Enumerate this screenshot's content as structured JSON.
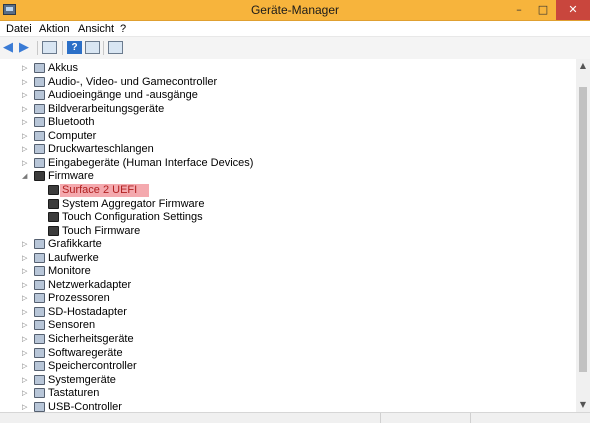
{
  "window": {
    "title": "Geräte-Manager",
    "minimize_glyph": "–",
    "maximize_glyph": "□",
    "close_glyph": "✕"
  },
  "menubar": {
    "items": [
      "Datei",
      "Aktion",
      "Ansicht",
      "?"
    ]
  },
  "toolbar": {
    "back_glyph": "◀",
    "forward_glyph": "▶",
    "help_glyph": "?"
  },
  "tree": {
    "collapsed_glyph": "▷",
    "expanded_glyph": "◢",
    "items": [
      {
        "label": "Akkus",
        "icon": "battery-icon",
        "expanded": false
      },
      {
        "label": "Audio-, Video- und Gamecontroller",
        "icon": "speaker-icon",
        "expanded": false
      },
      {
        "label": "Audioeingänge und -ausgänge",
        "icon": "speaker-icon",
        "expanded": false
      },
      {
        "label": "Bildverarbeitungsgeräte",
        "icon": "camera-icon",
        "expanded": false
      },
      {
        "label": "Bluetooth",
        "icon": "bluetooth-icon",
        "expanded": false
      },
      {
        "label": "Computer",
        "icon": "computer-icon",
        "expanded": false
      },
      {
        "label": "Druckwarteschlangen",
        "icon": "printer-icon",
        "expanded": false
      },
      {
        "label": "Eingabegeräte (Human Interface Devices)",
        "icon": "hid-icon",
        "expanded": false
      },
      {
        "label": "Firmware",
        "icon": "firmware-icon",
        "expanded": true
      },
      {
        "label": "Surface 2 UEFI",
        "icon": "firmware-chip-icon",
        "child": true,
        "selected": true
      },
      {
        "label": "System Aggregator Firmware",
        "icon": "firmware-chip-icon",
        "child": true
      },
      {
        "label": "Touch Configuration Settings",
        "icon": "firmware-chip-icon",
        "child": true
      },
      {
        "label": "Touch Firmware",
        "icon": "firmware-chip-icon",
        "child": true
      },
      {
        "label": "Grafikkarte",
        "icon": "display-adapter-icon",
        "expanded": false
      },
      {
        "label": "Laufwerke",
        "icon": "drive-icon",
        "expanded": false
      },
      {
        "label": "Monitore",
        "icon": "monitor-icon",
        "expanded": false
      },
      {
        "label": "Netzwerkadapter",
        "icon": "network-icon",
        "expanded": false
      },
      {
        "label": "Prozessoren",
        "icon": "processor-icon",
        "expanded": false
      },
      {
        "label": "SD-Hostadapter",
        "icon": "sd-card-icon",
        "expanded": false
      },
      {
        "label": "Sensoren",
        "icon": "sensor-icon",
        "expanded": false
      },
      {
        "label": "Sicherheitsgeräte",
        "icon": "key-icon",
        "expanded": false
      },
      {
        "label": "Softwaregeräte",
        "icon": "software-device-icon",
        "expanded": false
      },
      {
        "label": "Speichercontroller",
        "icon": "storage-controller-icon",
        "expanded": false
      },
      {
        "label": "Systemgeräte",
        "icon": "system-device-icon",
        "expanded": false
      },
      {
        "label": "Tastaturen",
        "icon": "keyboard-icon",
        "expanded": false
      },
      {
        "label": "USB-Controller",
        "icon": "usb-icon",
        "expanded": false
      }
    ]
  },
  "scrollbar": {
    "up_glyph": "▲",
    "down_glyph": "▼"
  },
  "colors": {
    "titlebar": "#f7b43c",
    "close_button": "#c9463d",
    "selection_bg": "#f4a9ae",
    "selection_text": "#b02020"
  }
}
